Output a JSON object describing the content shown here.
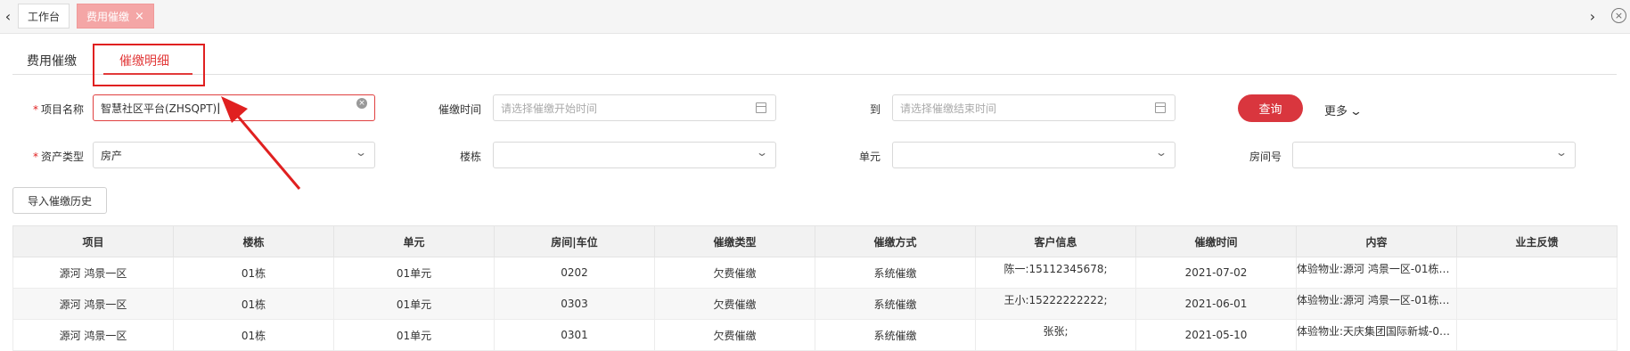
{
  "tabbar": {
    "tabs": [
      {
        "label": "工作台",
        "active": false
      },
      {
        "label": "费用催缴",
        "active": true
      }
    ]
  },
  "subtabs": [
    "费用催缴",
    "催缴明细"
  ],
  "form": {
    "project_label": "项目名称",
    "project_value": "智慧社区平台(ZHSQPT)",
    "time_label": "催缴时间",
    "time_start_placeholder": "请选择催缴开始时间",
    "to_label": "到",
    "time_end_placeholder": "请选择催缴结束时间",
    "query_label": "查询",
    "more_label": "更多",
    "asset_label": "资产类型",
    "asset_value": "房产",
    "building_label": "楼栋",
    "unit_label": "单元",
    "room_label": "房间号"
  },
  "import_label": "导入催缴历史",
  "table": {
    "headers": [
      "项目",
      "楼栋",
      "单元",
      "房间|车位",
      "催缴类型",
      "催缴方式",
      "客户信息",
      "催缴时间",
      "内容",
      "业主反馈"
    ],
    "rows": [
      [
        "源河 鸿景一区",
        "01栋",
        "01单元",
        "0202",
        "欠费催缴",
        "系统催缴",
        "陈一:15112345678;",
        "2021-07-02",
        "体验物业:源河 鸿景一区-01栋0…",
        ""
      ],
      [
        "源河 鸿景一区",
        "01栋",
        "01单元",
        "0303",
        "欠费催缴",
        "系统催缴",
        "王小:15222222222;",
        "2021-06-01",
        "体验物业:源河 鸿景一区-01栋0…",
        ""
      ],
      [
        "源河 鸿景一区",
        "01栋",
        "01单元",
        "0301",
        "欠费催缴",
        "系统催缴",
        "张张;",
        "2021-05-10",
        "体验物业:天庆集团国际新城-01…",
        ""
      ]
    ]
  },
  "colors": {
    "accent": "#e23a3a",
    "button": "#d9363e",
    "annotation": "#e02020"
  }
}
